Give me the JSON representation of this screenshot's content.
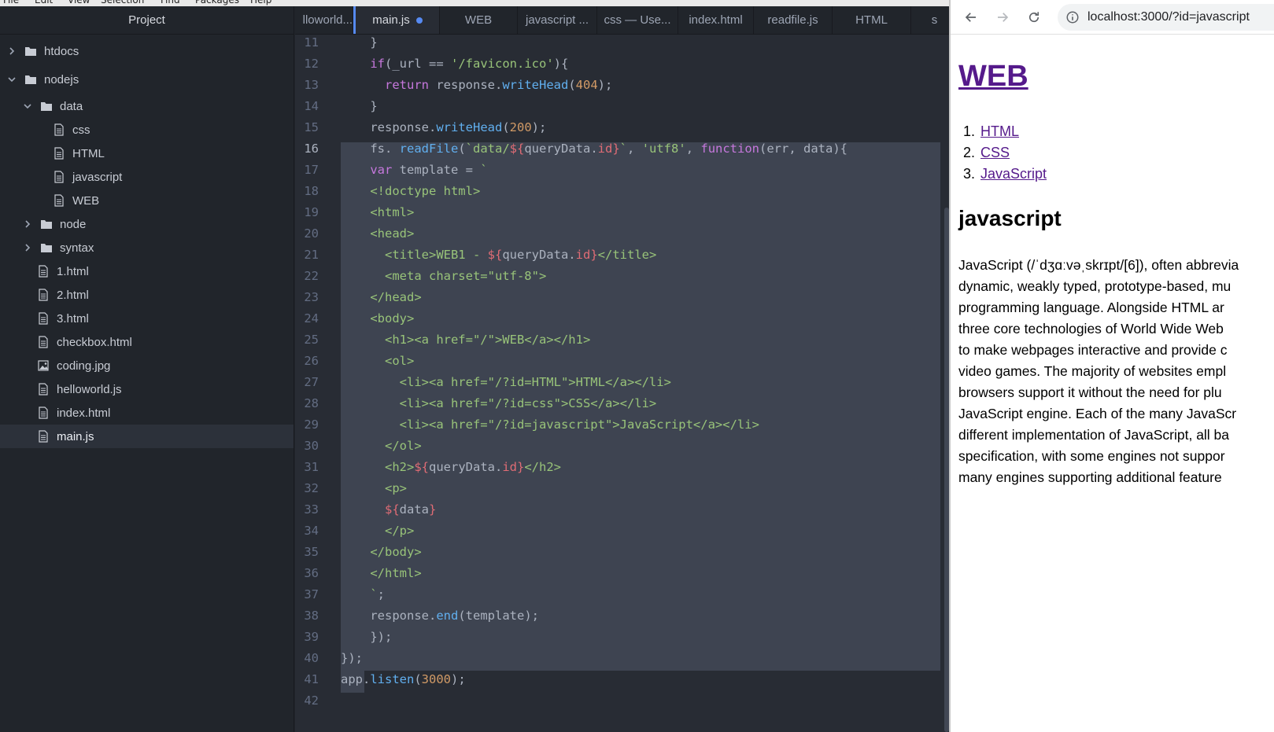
{
  "menubar": {
    "items": [
      "File",
      "Edit",
      "View",
      "Selection",
      "Find",
      "Packages",
      "Help"
    ]
  },
  "tree": {
    "header": "Project",
    "items": [
      {
        "label": "htdocs",
        "kind": "folder",
        "chevron": "right",
        "depth": 0
      },
      {
        "label": "nodejs",
        "kind": "folder",
        "chevron": "down",
        "depth": 0
      },
      {
        "label": "data",
        "kind": "folder",
        "chevron": "down",
        "depth": 1
      },
      {
        "label": "css",
        "kind": "file",
        "chevron": "none",
        "depth": 2
      },
      {
        "label": "HTML",
        "kind": "file",
        "chevron": "none",
        "depth": 2
      },
      {
        "label": "javascript",
        "kind": "file",
        "chevron": "none",
        "depth": 2
      },
      {
        "label": "WEB",
        "kind": "file",
        "chevron": "none",
        "depth": 2
      },
      {
        "label": "node",
        "kind": "folder",
        "chevron": "right",
        "depth": 1
      },
      {
        "label": "syntax",
        "kind": "folder",
        "chevron": "right",
        "depth": 1
      },
      {
        "label": "1.html",
        "kind": "file",
        "chevron": "none",
        "depth": 1
      },
      {
        "label": "2.html",
        "kind": "file",
        "chevron": "none",
        "depth": 1
      },
      {
        "label": "3.html",
        "kind": "file",
        "chevron": "none",
        "depth": 1
      },
      {
        "label": "checkbox.html",
        "kind": "file",
        "chevron": "none",
        "depth": 1
      },
      {
        "label": "coding.jpg",
        "kind": "image",
        "chevron": "none",
        "depth": 1
      },
      {
        "label": "helloworld.js",
        "kind": "file",
        "chevron": "none",
        "depth": 1
      },
      {
        "label": "index.html",
        "kind": "file",
        "chevron": "none",
        "depth": 1
      },
      {
        "label": "main.js",
        "kind": "file",
        "chevron": "none",
        "depth": 1,
        "selected": true
      }
    ]
  },
  "tabs": [
    {
      "label": "lloworld...",
      "active": false
    },
    {
      "label": "main.js",
      "active": true,
      "modified": true
    },
    {
      "label": "WEB",
      "active": false
    },
    {
      "label": "javascript ...",
      "active": false
    },
    {
      "label": "css — Use...",
      "active": false
    },
    {
      "label": "index.html",
      "active": false
    },
    {
      "label": "readfile.js",
      "active": false
    },
    {
      "label": "HTML",
      "active": false
    },
    {
      "label": "s",
      "active": false
    }
  ],
  "editor": {
    "first_line": 11,
    "highlighted_line": 16,
    "lines": [
      [
        [
          "pl",
          "    }"
        ]
      ],
      [
        [
          "pl",
          "    "
        ],
        [
          "kw",
          "if"
        ],
        [
          "pl",
          "(_url == "
        ],
        [
          "str",
          "'/favicon.ico'"
        ],
        [
          "pl",
          "){"
        ]
      ],
      [
        [
          "pl",
          "      "
        ],
        [
          "kw",
          "return"
        ],
        [
          "pl",
          " response."
        ],
        [
          "fn",
          "writeHead"
        ],
        [
          "pl",
          "("
        ],
        [
          "num",
          "404"
        ],
        [
          "pl",
          ");"
        ]
      ],
      [
        [
          "pl",
          "    }"
        ]
      ],
      [
        [
          "pl",
          "    response."
        ],
        [
          "fn",
          "writeHead"
        ],
        [
          "pl",
          "("
        ],
        [
          "num",
          "200"
        ],
        [
          "pl",
          ");"
        ]
      ],
      [
        [
          "pl",
          "    fs. "
        ],
        [
          "fn",
          "readFile"
        ],
        [
          "pl",
          "("
        ],
        [
          "str",
          "`data/"
        ],
        [
          "int",
          "${"
        ],
        [
          "pl",
          "queryData."
        ],
        [
          "int",
          "id"
        ],
        [
          "int",
          "}"
        ],
        [
          "str",
          "`"
        ],
        [
          "pl",
          ", "
        ],
        [
          "str",
          "'utf8'"
        ],
        [
          "pl",
          ", "
        ],
        [
          "kw",
          "function"
        ],
        [
          "pl",
          "(err, data){"
        ]
      ],
      [
        [
          "pl",
          "    "
        ],
        [
          "kw",
          "var"
        ],
        [
          "pl",
          " template = "
        ],
        [
          "str",
          "`"
        ]
      ],
      [
        [
          "str",
          "    <!doctype html>"
        ]
      ],
      [
        [
          "str",
          "    <html>"
        ]
      ],
      [
        [
          "str",
          "    <head>"
        ]
      ],
      [
        [
          "str",
          "      <title>WEB1 - "
        ],
        [
          "int",
          "${"
        ],
        [
          "pl",
          "queryData."
        ],
        [
          "int",
          "id"
        ],
        [
          "int",
          "}"
        ],
        [
          "str",
          "</title>"
        ]
      ],
      [
        [
          "str",
          "      <meta charset=\"utf-8\">"
        ]
      ],
      [
        [
          "str",
          "    </head>"
        ]
      ],
      [
        [
          "str",
          "    <body>"
        ]
      ],
      [
        [
          "str",
          "      <h1><a href=\"/\">WEB</a></h1>"
        ]
      ],
      [
        [
          "str",
          "      <ol>"
        ]
      ],
      [
        [
          "str",
          "        <li><a href=\"/?id=HTML\">HTML</a></li>"
        ]
      ],
      [
        [
          "str",
          "        <li><a href=\"/?id=css\">CSS</a></li>"
        ]
      ],
      [
        [
          "str",
          "        <li><a href=\"/?id=javascript\">JavaScript</a></li>"
        ]
      ],
      [
        [
          "str",
          "      </ol>"
        ]
      ],
      [
        [
          "str",
          "      <h2>"
        ],
        [
          "int",
          "${"
        ],
        [
          "pl",
          "queryData."
        ],
        [
          "int",
          "id"
        ],
        [
          "int",
          "}"
        ],
        [
          "str",
          "</h2>"
        ]
      ],
      [
        [
          "str",
          "      <p>"
        ]
      ],
      [
        [
          "str",
          "      "
        ],
        [
          "int",
          "${"
        ],
        [
          "pl",
          "data"
        ],
        [
          "int",
          "}"
        ]
      ],
      [
        [
          "str",
          "      </p>"
        ]
      ],
      [
        [
          "str",
          "    </body>"
        ]
      ],
      [
        [
          "str",
          "    </html>"
        ]
      ],
      [
        [
          "str",
          "    `"
        ],
        [
          "pl",
          ";"
        ]
      ],
      [
        [
          "pl",
          "    response."
        ],
        [
          "fn",
          "end"
        ],
        [
          "pl",
          "(template);"
        ]
      ],
      [
        [
          "pl",
          "    });"
        ]
      ],
      [
        [
          "pl",
          "});"
        ]
      ],
      [
        [
          "pl",
          "app."
        ],
        [
          "fn",
          "listen"
        ],
        [
          "pl",
          "("
        ],
        [
          "num",
          "3000"
        ],
        [
          "pl",
          ");"
        ]
      ],
      [
        [
          "pl",
          ""
        ]
      ]
    ]
  },
  "browser": {
    "url": "localhost:3000/?id=javascript",
    "h1": "WEB",
    "list": [
      {
        "num": "1.",
        "label": "HTML"
      },
      {
        "num": "2.",
        "label": "CSS"
      },
      {
        "num": "3.",
        "label": "JavaScript"
      }
    ],
    "h2": "javascript",
    "paragraph_lines": [
      "JavaScript (/ˈdʒɑːvəˌskrɪpt/[6]), often abbrevia",
      "dynamic, weakly typed, prototype-based, mu",
      "programming language. Alongside HTML ar",
      "three core technologies of World Wide Web",
      "to make webpages interactive and provide c",
      "video games. The majority of websites empl",
      "browsers support it without the need for plu",
      "JavaScript engine. Each of the many JavaScr",
      "different implementation of JavaScript, all ba",
      "specification, with some engines not suppor",
      "many engines supporting additional feature"
    ]
  },
  "icons": {
    "folder": "folder-icon",
    "file": "file-text-icon",
    "image": "image-file-icon",
    "back": "arrow-left-icon",
    "forward": "arrow-right-icon",
    "reload": "reload-icon",
    "info": "info-icon"
  },
  "colors": {
    "accent": "#568af2",
    "link_visited": "#551a8b",
    "selection": "#3e4451"
  }
}
